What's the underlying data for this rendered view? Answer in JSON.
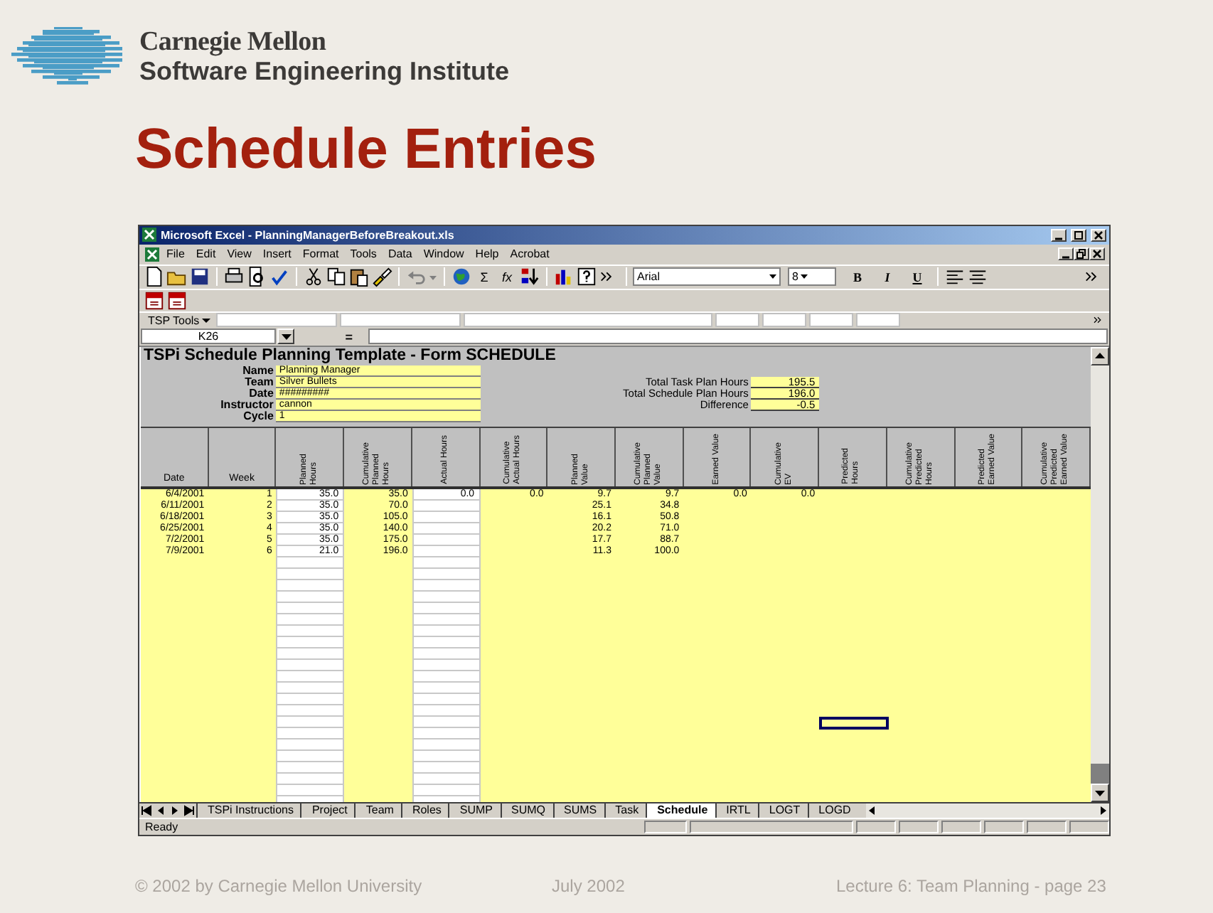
{
  "header": {
    "org_name": "Carnegie Mellon",
    "org_unit": "Software Engineering Institute"
  },
  "slide_title": "Schedule Entries",
  "excel": {
    "title": "Microsoft Excel - PlanningManagerBeforeBreakout.xls",
    "menu": [
      "File",
      "Edit",
      "View",
      "Insert",
      "Format",
      "Tools",
      "Data",
      "Window",
      "Help",
      "Acrobat"
    ],
    "formula_buttons": [
      "Σ",
      "fx"
    ],
    "font_name": "Arial",
    "font_size": "8",
    "format_buttons": [
      "B",
      "I",
      "U"
    ],
    "tsp_tools": "TSP Tools",
    "name_box": "K26",
    "formula_equals": "=",
    "sheet": {
      "title": "TSPi Schedule Planning Template - Form SCHEDULE",
      "fields": [
        {
          "label": "Name",
          "value": "Planning Manager"
        },
        {
          "label": "Team",
          "value": "Silver Bullets"
        },
        {
          "label": "Date",
          "value": "#########"
        },
        {
          "label": "Instructor",
          "value": "cannon"
        },
        {
          "label": "Cycle",
          "value": "1"
        }
      ],
      "totals": [
        {
          "label": "Total Task Plan Hours",
          "value": "195.5"
        },
        {
          "label": "Total Schedule Plan Hours",
          "value": "196.0"
        },
        {
          "label": "Difference",
          "value": "-0.5"
        }
      ],
      "columns": [
        {
          "lines": [
            "Date"
          ],
          "rotated": false,
          "kind": "computed"
        },
        {
          "lines": [
            "Week"
          ],
          "rotated": false,
          "kind": "computed"
        },
        {
          "lines": [
            "Planned",
            "Hours"
          ],
          "rotated": true,
          "kind": "input"
        },
        {
          "lines": [
            "Cumulative",
            "Planned",
            "Hours"
          ],
          "rotated": true,
          "kind": "computed"
        },
        {
          "lines": [
            "Actual Hours"
          ],
          "rotated": true,
          "kind": "input"
        },
        {
          "lines": [
            "Cumulative",
            "Actual Hours"
          ],
          "rotated": true,
          "kind": "computed"
        },
        {
          "lines": [
            "Planned",
            "Value"
          ],
          "rotated": true,
          "kind": "computed"
        },
        {
          "lines": [
            "Cumulative",
            "Planned",
            "Value"
          ],
          "rotated": true,
          "kind": "computed"
        },
        {
          "lines": [
            "Earned Value"
          ],
          "rotated": true,
          "kind": "computed"
        },
        {
          "lines": [
            "Cumulative",
            "EV"
          ],
          "rotated": true,
          "kind": "computed"
        },
        {
          "lines": [
            "Predicted",
            "Hours"
          ],
          "rotated": true,
          "kind": "computed"
        },
        {
          "lines": [
            "Cumulative",
            "Predicted",
            "Hours"
          ],
          "rotated": true,
          "kind": "computed"
        },
        {
          "lines": [
            "Predicted",
            "Earned Value"
          ],
          "rotated": true,
          "kind": "computed"
        },
        {
          "lines": [
            "Cumulative",
            "Predicted",
            "Earned Value"
          ],
          "rotated": true,
          "kind": "computed"
        }
      ],
      "rows": [
        {
          "cells": [
            "6/4/2001",
            "1",
            "35.0",
            "35.0",
            "0.0",
            "0.0",
            "9.7",
            "9.7",
            "0.0",
            "0.0"
          ]
        },
        {
          "cells": [
            "6/11/2001",
            "2",
            "35.0",
            "70.0",
            null,
            null,
            "25.1",
            "34.8"
          ]
        },
        {
          "cells": [
            "6/18/2001",
            "3",
            "35.0",
            "105.0",
            null,
            null,
            "16.1",
            "50.8"
          ]
        },
        {
          "cells": [
            "6/25/2001",
            "4",
            "35.0",
            "140.0",
            null,
            null,
            "20.2",
            "71.0"
          ]
        },
        {
          "cells": [
            "7/2/2001",
            "5",
            "35.0",
            "175.0",
            null,
            null,
            "17.7",
            "88.7"
          ]
        },
        {
          "cells": [
            "7/9/2001",
            "6",
            "21.0",
            "196.0",
            null,
            null,
            "11.3",
            "100.0"
          ]
        }
      ]
    },
    "sheet_tabs": [
      {
        "label": "TSPi Instructions",
        "selected": false
      },
      {
        "label": "Project",
        "selected": false
      },
      {
        "label": "Team",
        "selected": false
      },
      {
        "label": "Roles",
        "selected": false
      },
      {
        "label": "SUMP",
        "selected": false
      },
      {
        "label": "SUMQ",
        "selected": false
      },
      {
        "label": "SUMS",
        "selected": false
      },
      {
        "label": "Task",
        "selected": false
      },
      {
        "label": "Schedule",
        "selected": true
      },
      {
        "label": "IRTL",
        "selected": false
      },
      {
        "label": "LOGT",
        "selected": false
      },
      {
        "label": "LOGD",
        "selected": false
      }
    ],
    "status": "Ready"
  },
  "footer": {
    "copyright": "© 2002 by Carnegie Mellon University",
    "date": "July 2002",
    "page": "Lecture 6: Team Planning - page 23"
  }
}
